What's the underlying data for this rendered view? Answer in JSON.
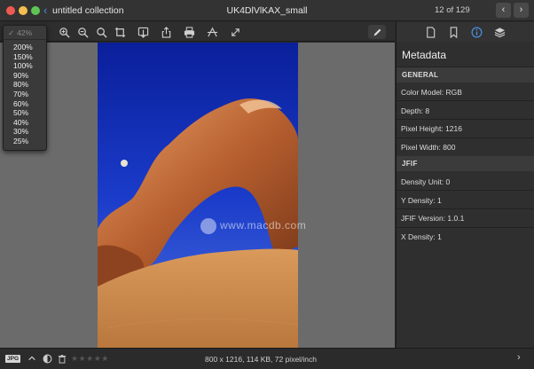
{
  "titlebar": {
    "collection": "untitled collection",
    "title": "UK4DlVlKAX_small",
    "counter": "12 of 129",
    "prev_label": "‹",
    "next_label": "›"
  },
  "zoom": {
    "current": "42%",
    "options": [
      "200%",
      "150%",
      "100%",
      "90%",
      "80%",
      "70%",
      "60%",
      "50%",
      "40%",
      "30%",
      "25%"
    ]
  },
  "toolbar": {
    "icons": [
      "zoom-in-icon",
      "zoom-out-icon",
      "zoom-fit-icon",
      "crop-icon",
      "import-icon",
      "share-icon",
      "print-icon",
      "adjust-icon",
      "fullscreen-icon",
      "pencil-icon"
    ]
  },
  "inspector": {
    "title": "Metadata",
    "sections": [
      {
        "header": "GENERAL",
        "props": [
          "Color Model: RGB",
          "Depth: 8",
          "Pixel Height: 1216",
          "Pixel Width: 800"
        ]
      },
      {
        "header": "JFIF",
        "props": [
          "Density Unit: 0",
          "Y Density: 1",
          "JFIF Version: 1.0.1",
          "X Density: 1"
        ]
      }
    ]
  },
  "watermark": "www.macdb.com",
  "statusbar": {
    "format_badge": "JPG",
    "rating_stars": "★★★★★",
    "rating_value": 0,
    "info": "800 x 1216, 114 KB, 72 pixel/inch",
    "chevron": "›"
  },
  "colors": {
    "accent": "#4a90e2",
    "canvas_bg": "#6b6b6b",
    "panel_bg": "#2f2f2f"
  }
}
